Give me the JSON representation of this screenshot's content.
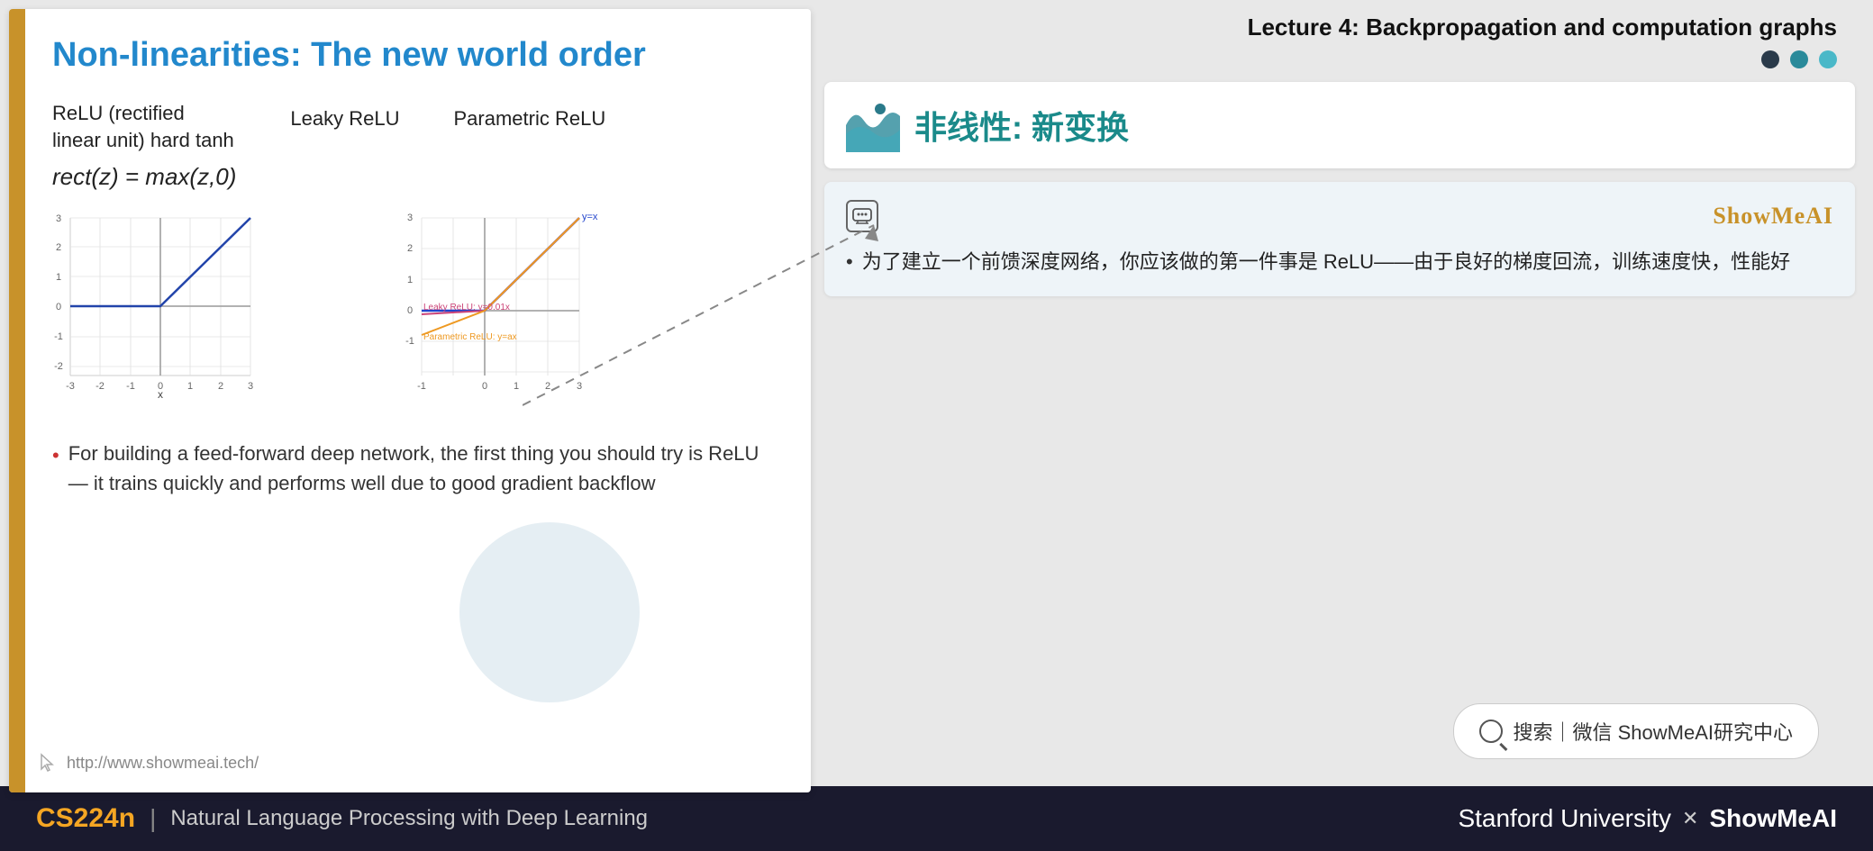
{
  "slide": {
    "title": "Non-linearities: The new world order",
    "left_bar_color": "#c8922a",
    "formula_cols": [
      {
        "title": "ReLU (rectified",
        "subtitle": "linear unit) hard tanh",
        "math": "rect(z) = max(z,0)"
      },
      {
        "title": "Leaky ReLU",
        "subtitle": "",
        "math": ""
      },
      {
        "title": "Parametric ReLU",
        "subtitle": "",
        "math": ""
      }
    ],
    "bullet": "For building a feed-forward deep network, the first thing you should try is ReLU — it trains quickly and performs well due to good gradient backflow",
    "url": "http://www.showmeai.tech/"
  },
  "right_panel": {
    "lecture_title": "Lecture 4:  Backpropagation and computation graphs",
    "nav_dots": [
      "dark",
      "teal",
      "light-teal"
    ],
    "section_title": "非线性: 新变换",
    "ai_card": {
      "brand": "ShowMeAI",
      "bullet": "为了建立一个前馈深度网络，你应该做的第一件事是 ReLU——由于良好的梯度回流，训练速度快，性能好"
    },
    "search_text": "搜索｜微信 ShowMeAI研究中心"
  },
  "bottom_bar": {
    "course": "CS224n",
    "divider": "|",
    "description": "Natural Language Processing with Deep Learning",
    "right_text": "Stanford University",
    "x_symbol": "✕",
    "brand": "ShowMeAI"
  }
}
